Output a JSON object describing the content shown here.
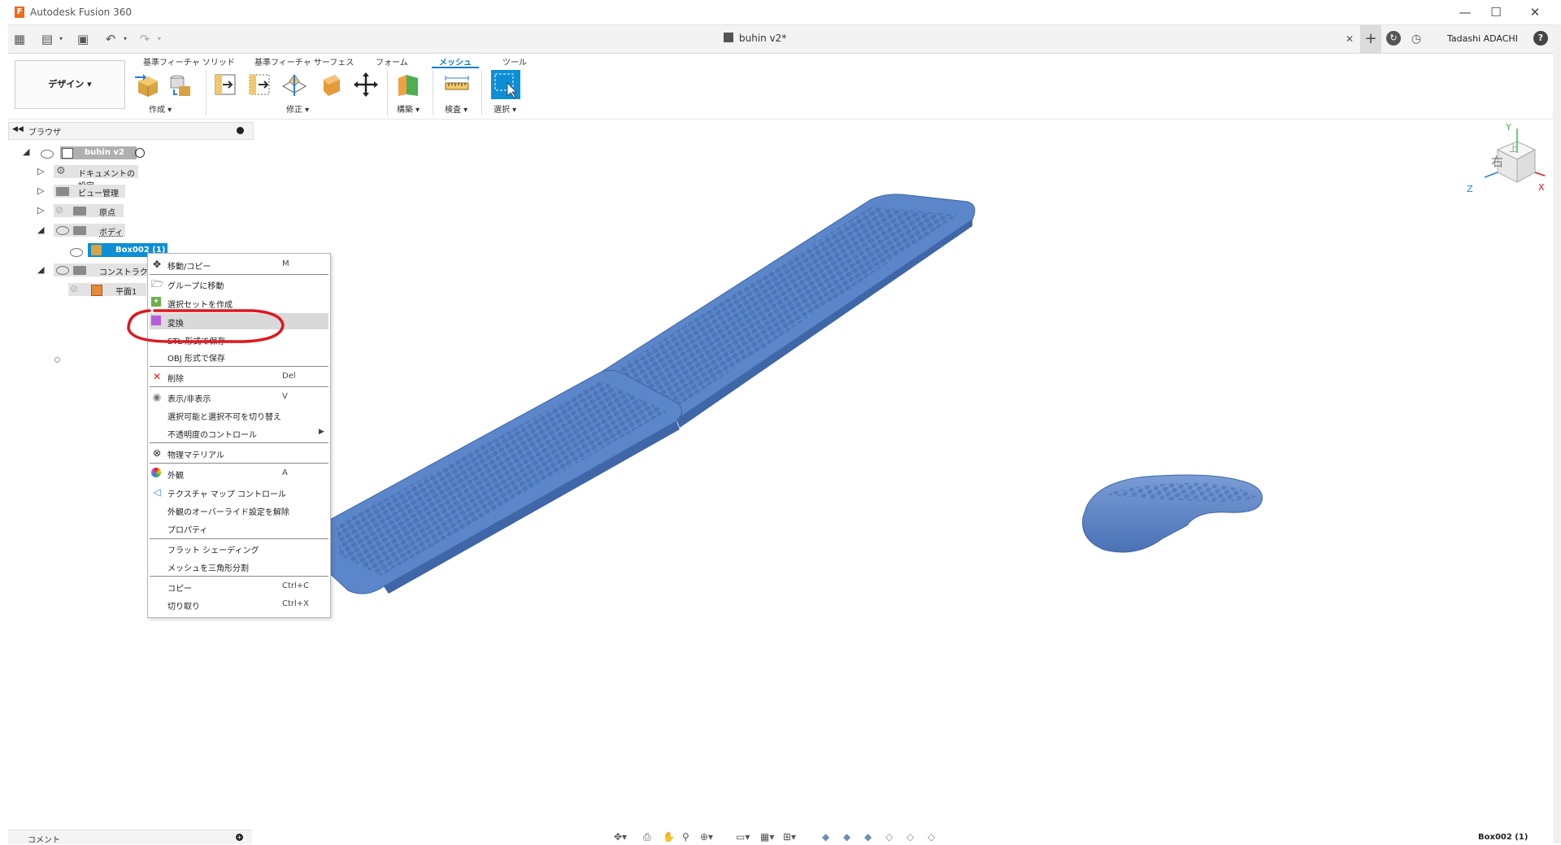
{
  "window": {
    "app_title": "Autodesk Fusion 360",
    "app_icon_letter": "F",
    "minimize": "—",
    "maximize": "☐",
    "close": "✕"
  },
  "toolbar": {
    "document_tab": "buhin v2*",
    "tab_close": "✕",
    "user_name": "Tadashi ADACHI",
    "help": "?"
  },
  "ribbon": {
    "workspace": "デザイン ▾",
    "tabs": [
      "基準フィーチャ ソリッド",
      "基準フィーチャ サーフェス",
      "フォーム",
      "メッシュ",
      "ツール"
    ],
    "active_tab": "メッシュ",
    "groups": [
      "作成 ▾",
      "修正 ▾",
      "構築 ▾",
      "検査 ▾",
      "選択 ▾"
    ]
  },
  "browser": {
    "title": "ブラウザ",
    "items": [
      {
        "label": "buhin v2"
      },
      {
        "label": "ドキュメントの設定"
      },
      {
        "label": "ビュー管理"
      },
      {
        "label": "原点"
      },
      {
        "label": "ボディ"
      },
      {
        "label": "Box002 (1)"
      },
      {
        "label": "コンストラクション"
      },
      {
        "label": "平面1"
      }
    ]
  },
  "context_menu": {
    "items": [
      {
        "label": "移動/コピー",
        "shortcut": "M",
        "icon": "move-icon"
      },
      {
        "label": "グループに移動",
        "shortcut": "",
        "icon": "group-move-icon"
      },
      {
        "label": "選択セットを作成",
        "shortcut": "",
        "icon": "selection-set-icon"
      },
      {
        "label": "変換",
        "shortcut": "",
        "icon": "convert-icon"
      },
      {
        "label": "STL 形式で保存",
        "shortcut": "",
        "icon": ""
      },
      {
        "label": "OBJ 形式で保存",
        "shortcut": "",
        "icon": ""
      },
      {
        "label": "削除",
        "shortcut": "Del",
        "icon": "delete-icon"
      },
      {
        "label": "表示/非表示",
        "shortcut": "V",
        "icon": "eye-icon"
      },
      {
        "label": "選択可能と選択不可を切り替え",
        "shortcut": "",
        "icon": ""
      },
      {
        "label": "不透明度のコントロール",
        "shortcut": "▶",
        "icon": ""
      },
      {
        "label": "物理マテリアル",
        "shortcut": "",
        "icon": "material-icon"
      },
      {
        "label": "外観",
        "shortcut": "A",
        "icon": "appearance-icon"
      },
      {
        "label": "テクスチャ マップ コントロール",
        "shortcut": "",
        "icon": "texture-map-icon"
      },
      {
        "label": "外観のオーバーライド設定を解除",
        "shortcut": "",
        "icon": ""
      },
      {
        "label": "プロパティ",
        "shortcut": "",
        "icon": ""
      },
      {
        "label": "フラット シェーディング",
        "shortcut": "",
        "icon": ""
      },
      {
        "label": "メッシュを三角形分割",
        "shortcut": "",
        "icon": ""
      },
      {
        "label": "コピー",
        "shortcut": "Ctrl+C",
        "icon": ""
      },
      {
        "label": "切り取り",
        "shortcut": "Ctrl+X",
        "icon": ""
      }
    ]
  },
  "viewcube": {
    "face_front": "右",
    "face_top": "上",
    "x": "X",
    "y": "Y",
    "z": "Z"
  },
  "status": {
    "comment_label": "コメント",
    "selection": "Box002 (1)"
  },
  "colors": {
    "accent": "#0a7bd8",
    "mesh": "#5b86c9",
    "annotation": "#e0171e"
  }
}
